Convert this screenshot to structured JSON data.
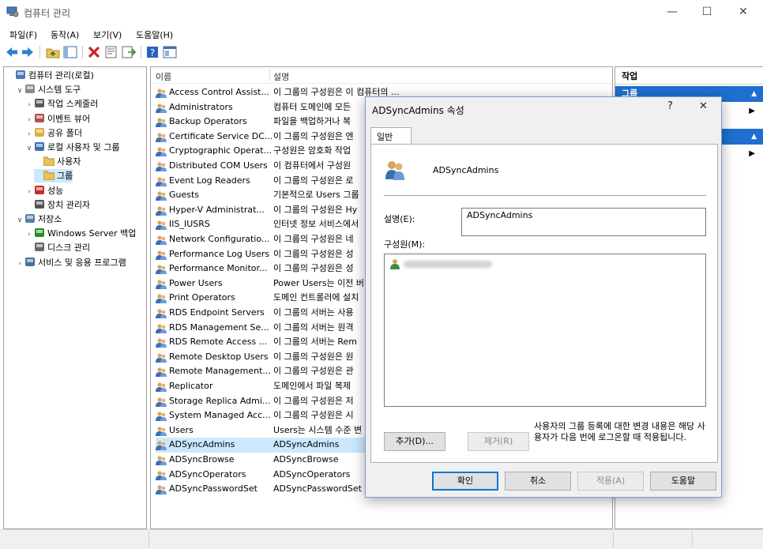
{
  "window": {
    "title": "컴퓨터 관리",
    "caption_minimize": "—",
    "caption_maximize": "☐",
    "caption_close": "✕"
  },
  "menu": [
    "파일(F)",
    "동작(A)",
    "보기(V)",
    "도움말(H)"
  ],
  "toolbar": {
    "icons": [
      "back-icon",
      "forward-icon",
      "up-folder-icon",
      "show-hide-tree-icon",
      "delete-icon",
      "properties-icon",
      "export-list-icon",
      "help-icon",
      "mmc-view-icon"
    ]
  },
  "tree": [
    {
      "label": "컴퓨터 관리(로컬)",
      "icon": "computer-management-icon",
      "expander": ""
    },
    {
      "label": "시스템 도구",
      "icon": "system-tools-icon",
      "expander": "∨"
    },
    {
      "label": "작업 스케줄러",
      "icon": "task-scheduler-icon",
      "expander": "›"
    },
    {
      "label": "이벤트 뷰어",
      "icon": "event-viewer-icon",
      "expander": "›"
    },
    {
      "label": "공유 폴더",
      "icon": "shared-folder-icon",
      "expander": "›"
    },
    {
      "label": "로컬 사용자 및 그룹",
      "icon": "local-users-groups-icon",
      "expander": "∨"
    },
    {
      "label": "사용자",
      "icon": "folder-icon",
      "expander": ""
    },
    {
      "label": "그룹",
      "icon": "folder-icon",
      "expander": ""
    },
    {
      "label": "성능",
      "icon": "performance-icon",
      "expander": "›"
    },
    {
      "label": "장치 관리자",
      "icon": "device-manager-icon",
      "expander": ""
    },
    {
      "label": "저장소",
      "icon": "storage-icon",
      "expander": "∨"
    },
    {
      "label": "Windows Server 백업",
      "icon": "server-backup-icon",
      "expander": "›"
    },
    {
      "label": "디스크 관리",
      "icon": "disk-management-icon",
      "expander": ""
    },
    {
      "label": "서비스 및 응용 프로그램",
      "icon": "services-apps-icon",
      "expander": "›"
    }
  ],
  "list": {
    "col_name": "이름",
    "col_desc": "설명",
    "rows": [
      {
        "name": "Access Control Assist...",
        "desc": "이 그룹의 구성원은 이 컴퓨터의 ..."
      },
      {
        "name": "Administrators",
        "desc": "컴퓨터 도메인에 모든"
      },
      {
        "name": "Backup Operators",
        "desc": "파일을 백업하거나 복"
      },
      {
        "name": "Certificate Service DC...",
        "desc": "이 그룹의 구성원은 엔"
      },
      {
        "name": "Cryptographic Operat...",
        "desc": "구성원은 암호화 작업"
      },
      {
        "name": "Distributed COM Users",
        "desc": "이 컴퓨터에서 구성원"
      },
      {
        "name": "Event Log Readers",
        "desc": "이 그룹의 구성원은 로"
      },
      {
        "name": "Guests",
        "desc": "기본적으로 Users 그룹"
      },
      {
        "name": "Hyper-V Administrat...",
        "desc": "이 그룹의 구성원은 Hy"
      },
      {
        "name": "IIS_IUSRS",
        "desc": "인터넷 정보 서비스에서"
      },
      {
        "name": "Network Configuratio...",
        "desc": "이 그룹의 구성원은 네"
      },
      {
        "name": "Performance Log Users",
        "desc": "이 그룹의 구성원은 성"
      },
      {
        "name": "Performance Monitor...",
        "desc": "이 그룹의 구성원은 성"
      },
      {
        "name": "Power Users",
        "desc": "Power Users는 이전 버"
      },
      {
        "name": "Print Operators",
        "desc": "도메인 컨트롤러에 설치"
      },
      {
        "name": "RDS Endpoint Servers",
        "desc": "이 그룹의 서버는 사용"
      },
      {
        "name": "RDS Management Se...",
        "desc": "이 그룹의 서버는 원격"
      },
      {
        "name": "RDS Remote Access ...",
        "desc": "이 그룹의 서버는 Rem"
      },
      {
        "name": "Remote Desktop Users",
        "desc": "이 그룹의 구성원은 원"
      },
      {
        "name": "Remote Management...",
        "desc": "이 그룹의 구성원은 관"
      },
      {
        "name": "Replicator",
        "desc": "도메인에서 파일 복제"
      },
      {
        "name": "Storage Replica Admi...",
        "desc": "이 그룹의 구성원은 저"
      },
      {
        "name": "System Managed Acc...",
        "desc": "이 그룹의 구성원은 시"
      },
      {
        "name": "Users",
        "desc": "Users는 시스템 수준 변"
      },
      {
        "name": "ADSyncAdmins",
        "desc": "ADSyncAdmins"
      },
      {
        "name": "ADSyncBrowse",
        "desc": "ADSyncBrowse"
      },
      {
        "name": "ADSyncOperators",
        "desc": "ADSyncOperators"
      },
      {
        "name": "ADSyncPasswordSet",
        "desc": "ADSyncPasswordSet"
      }
    ],
    "selected_row": "ADSyncAdmins"
  },
  "actions": {
    "header": "작업",
    "section1": "그룹",
    "more1": "▶",
    "more2": "▶",
    "collapse1": "▲",
    "collapse2": "▲"
  },
  "dialog": {
    "title": "ADSyncAdmins 속성",
    "help_glyph": "?",
    "close_glyph": "✕",
    "tab_general": "일반",
    "group_name": "ADSyncAdmins",
    "desc_label": "설명(E):",
    "desc_value": "ADSyncAdmins",
    "members_label": "구성원(M):",
    "member_redacted": "[redacted]",
    "note": "사용자의 그룹 등록에 대한 변경 내용은 해당 사용자가 다음 번에 로그온할 때 적용됩니다.",
    "add_button": "추가(D)...",
    "remove_button": "제거(R)",
    "ok_button": "확인",
    "cancel_button": "취소",
    "apply_button": "적용(A)",
    "help_button": "도움말"
  },
  "colors": {
    "selection": "#cce8ff",
    "accent": "#0078d7",
    "action_header": "#1e6fd0"
  }
}
